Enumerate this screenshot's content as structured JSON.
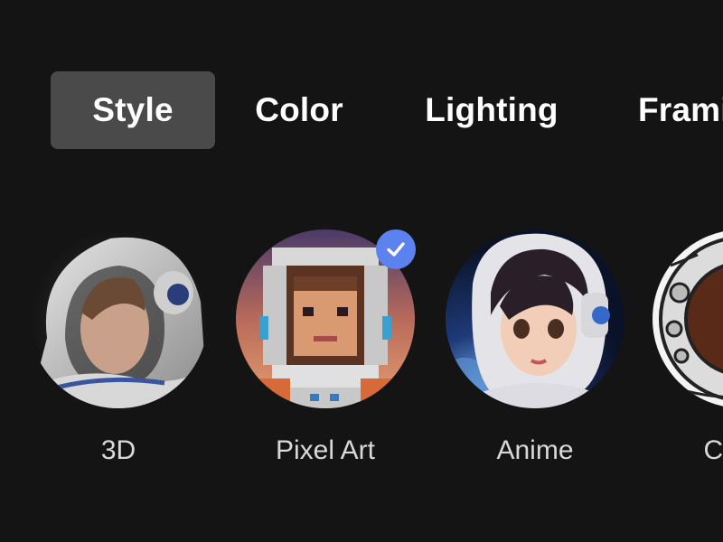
{
  "tabs": [
    {
      "label": "Style",
      "active": true
    },
    {
      "label": "Color",
      "active": false
    },
    {
      "label": "Lighting",
      "active": false
    },
    {
      "label": "Framing",
      "active": false
    }
  ],
  "options": [
    {
      "label": "3D",
      "selected": false
    },
    {
      "label": "Pixel Art",
      "selected": true
    },
    {
      "label": "Anime",
      "selected": false
    },
    {
      "label": "Comic",
      "selected": false
    }
  ],
  "icons": {
    "selected_check": "check-icon"
  },
  "colors": {
    "background": "#141414",
    "active_tab": "#4a4a4a",
    "check_badge": "#5b82ee",
    "option_label": "#d9d9d9"
  }
}
